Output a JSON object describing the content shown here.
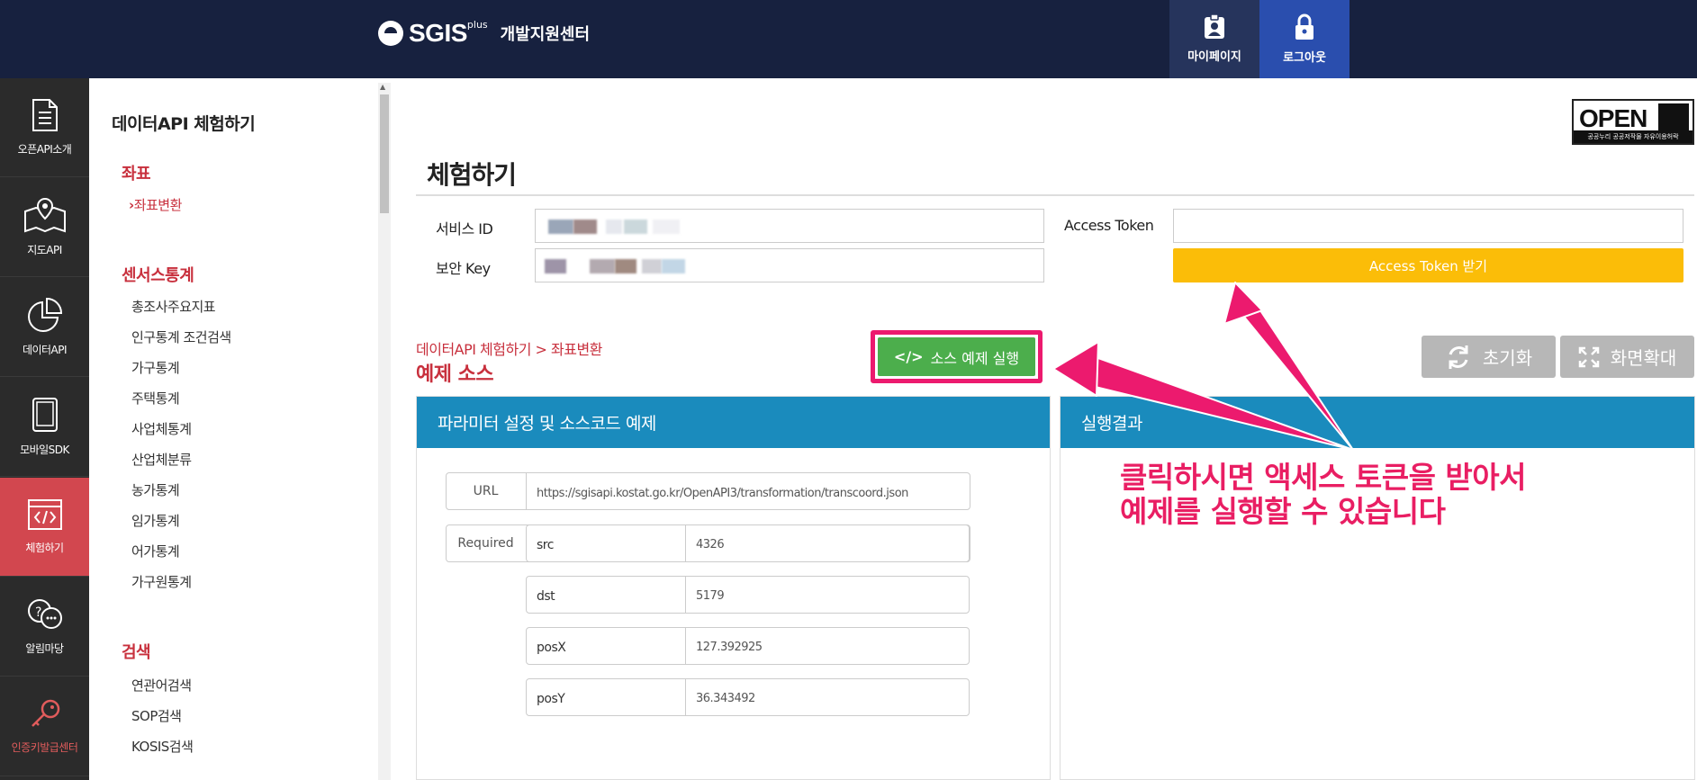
{
  "header": {
    "logo_text": "SGIS",
    "logo_plus": "plus",
    "logo_sub": "개발지원센터",
    "mypage_label": "마이페이지",
    "logout_label": "로그아웃"
  },
  "leftnav": {
    "items": [
      {
        "label": "오픈API소개",
        "icon": "document-icon"
      },
      {
        "label": "지도API",
        "icon": "map-pin-icon"
      },
      {
        "label": "데이터API",
        "icon": "pie-chart-icon"
      },
      {
        "label": "모바일SDK",
        "icon": "tablet-icon"
      },
      {
        "label": "체험하기",
        "icon": "code-window-icon",
        "active": true
      },
      {
        "label": "알림마당",
        "icon": "chat-bubbles-icon"
      },
      {
        "label": "인증키발급센터",
        "icon": "key-icon"
      }
    ]
  },
  "submenu": {
    "title": "데이터API 체험하기",
    "sections": [
      {
        "head": "좌표",
        "items": [
          "좌표변환"
        ]
      },
      {
        "head": "센서스통계",
        "items": [
          "총조사주요지표",
          "인구통계 조건검색",
          "가구통계",
          "주택통계",
          "사업체통계",
          "산업체분류",
          "농가통계",
          "임가통계",
          "어가통계",
          "가구원통계"
        ]
      },
      {
        "head": "검색",
        "items": [
          "연관어검색",
          "SOP검색",
          "KOSIS검색"
        ]
      }
    ]
  },
  "main": {
    "open_badge": {
      "text": "OPEN",
      "footer": "공공누리  공공저작물 자유이용허락"
    },
    "title": "체험하기",
    "service_id_label": "서비스 ID",
    "secure_key_label": "보안 Key",
    "access_token_label": "Access Token",
    "access_token_button": "Access Token 받기",
    "breadcrumb": "데이터API 체험하기 > 좌표변환",
    "example_title": "예제 소스",
    "run_button": "소스 예제 실행",
    "run_glyph": "</>",
    "reset_button": "초기화",
    "fullscreen_button": "화면확대",
    "left_panel_title": "파라미터 설정 및 소스코드 예제",
    "right_panel_title": "실행결과",
    "params": {
      "url_label": "URL",
      "url_value": "https://sgisapi.kostat.go.kr/OpenAPI3/transformation/transcoord.json",
      "required_label": "Required",
      "rows": [
        {
          "key": "src",
          "value": "4326"
        },
        {
          "key": "dst",
          "value": "5179"
        },
        {
          "key": "posX",
          "value": "127.392925"
        },
        {
          "key": "posY",
          "value": "36.343492"
        }
      ]
    },
    "annotation": {
      "line1": "클릭하시면 액세스 토큰을 받아서",
      "line2": "예제를 실행할 수 있습니다"
    }
  },
  "colors": {
    "header_bg": "#17213f",
    "active_nav": "#d2474f",
    "accent_red": "#c8303d",
    "token_yellow": "#fbbd08",
    "run_green": "#4cae4c",
    "panel_blue": "#1a8bbd",
    "annotation_pink": "#e91e63"
  }
}
